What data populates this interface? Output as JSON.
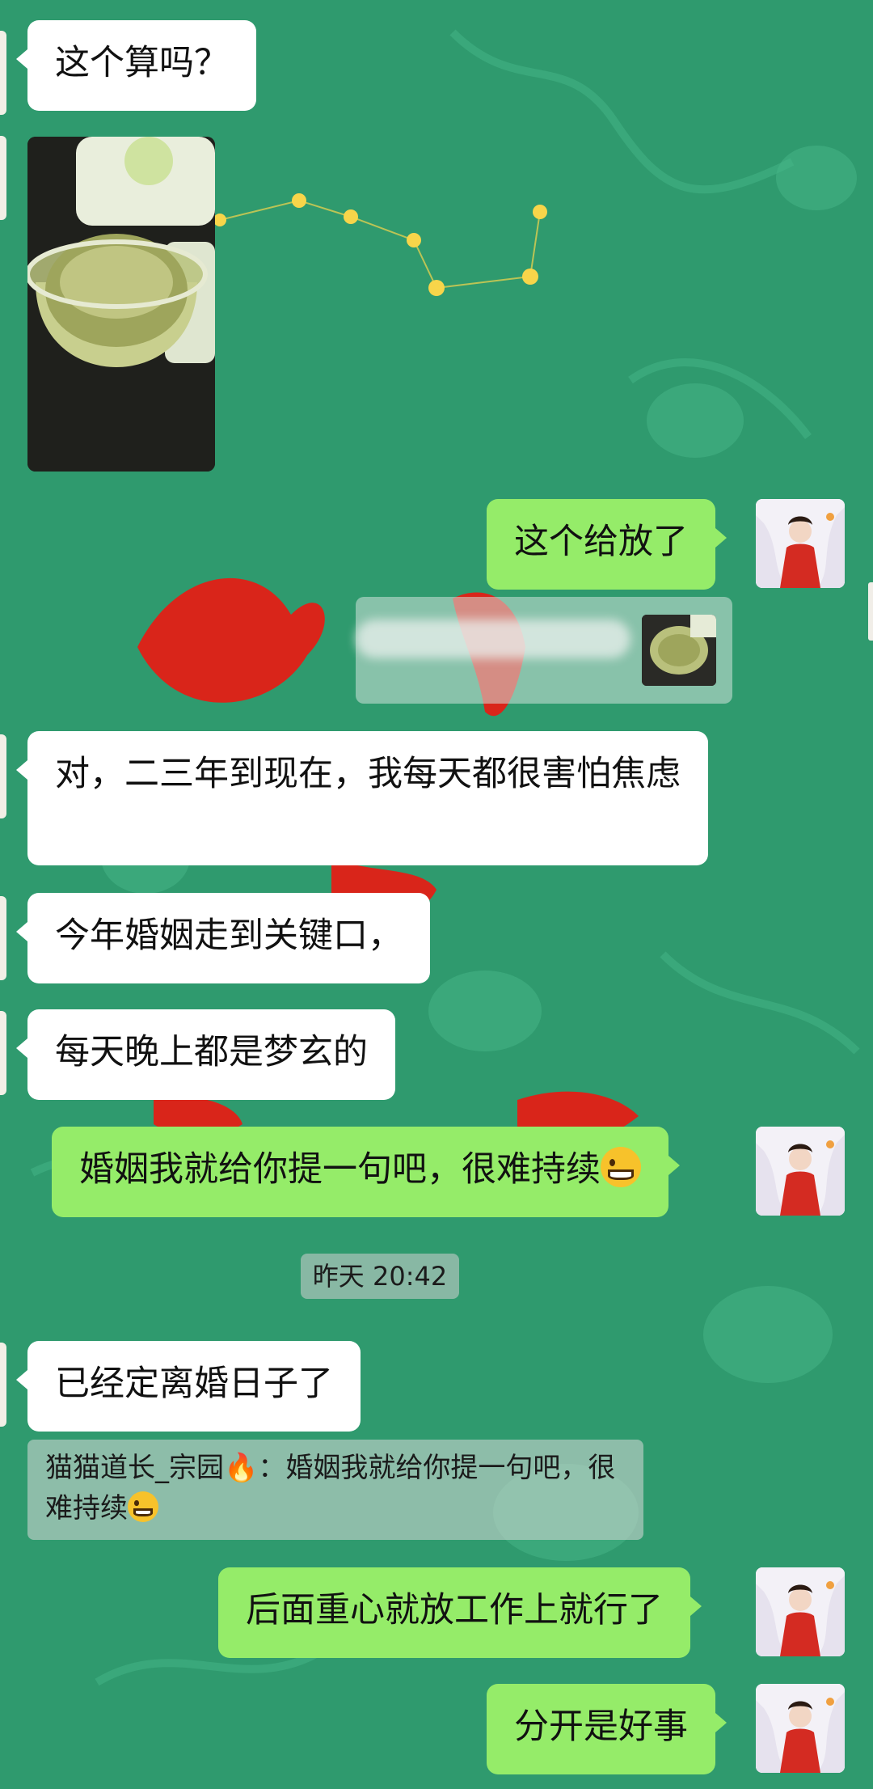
{
  "messages": {
    "m1": "这个算吗？",
    "m2": "这个给放了",
    "m3": "对，二三年到现在，我每天都很害怕焦虑",
    "m4": "今年婚姻走到关键口，",
    "m5": "每天晚上都是梦玄的",
    "m6": "婚姻我就给你提一句吧，很难持续",
    "m7": "已经定离婚日子了",
    "m8": "后面重心就放工作上就行了",
    "m9": "分开是好事"
  },
  "timestamp": "昨天 20:42",
  "reply_quote": {
    "sender": "猫猫道长_宗园",
    "text": "：婚姻我就给你提一句吧，很难持续"
  },
  "icons": {
    "emoji_grin": "grinning-face-icon",
    "fire": "fire-icon"
  },
  "colors": {
    "background": "#2f9a6e",
    "incoming_bubble": "#ffffff",
    "outgoing_bubble": "#95ec69"
  }
}
